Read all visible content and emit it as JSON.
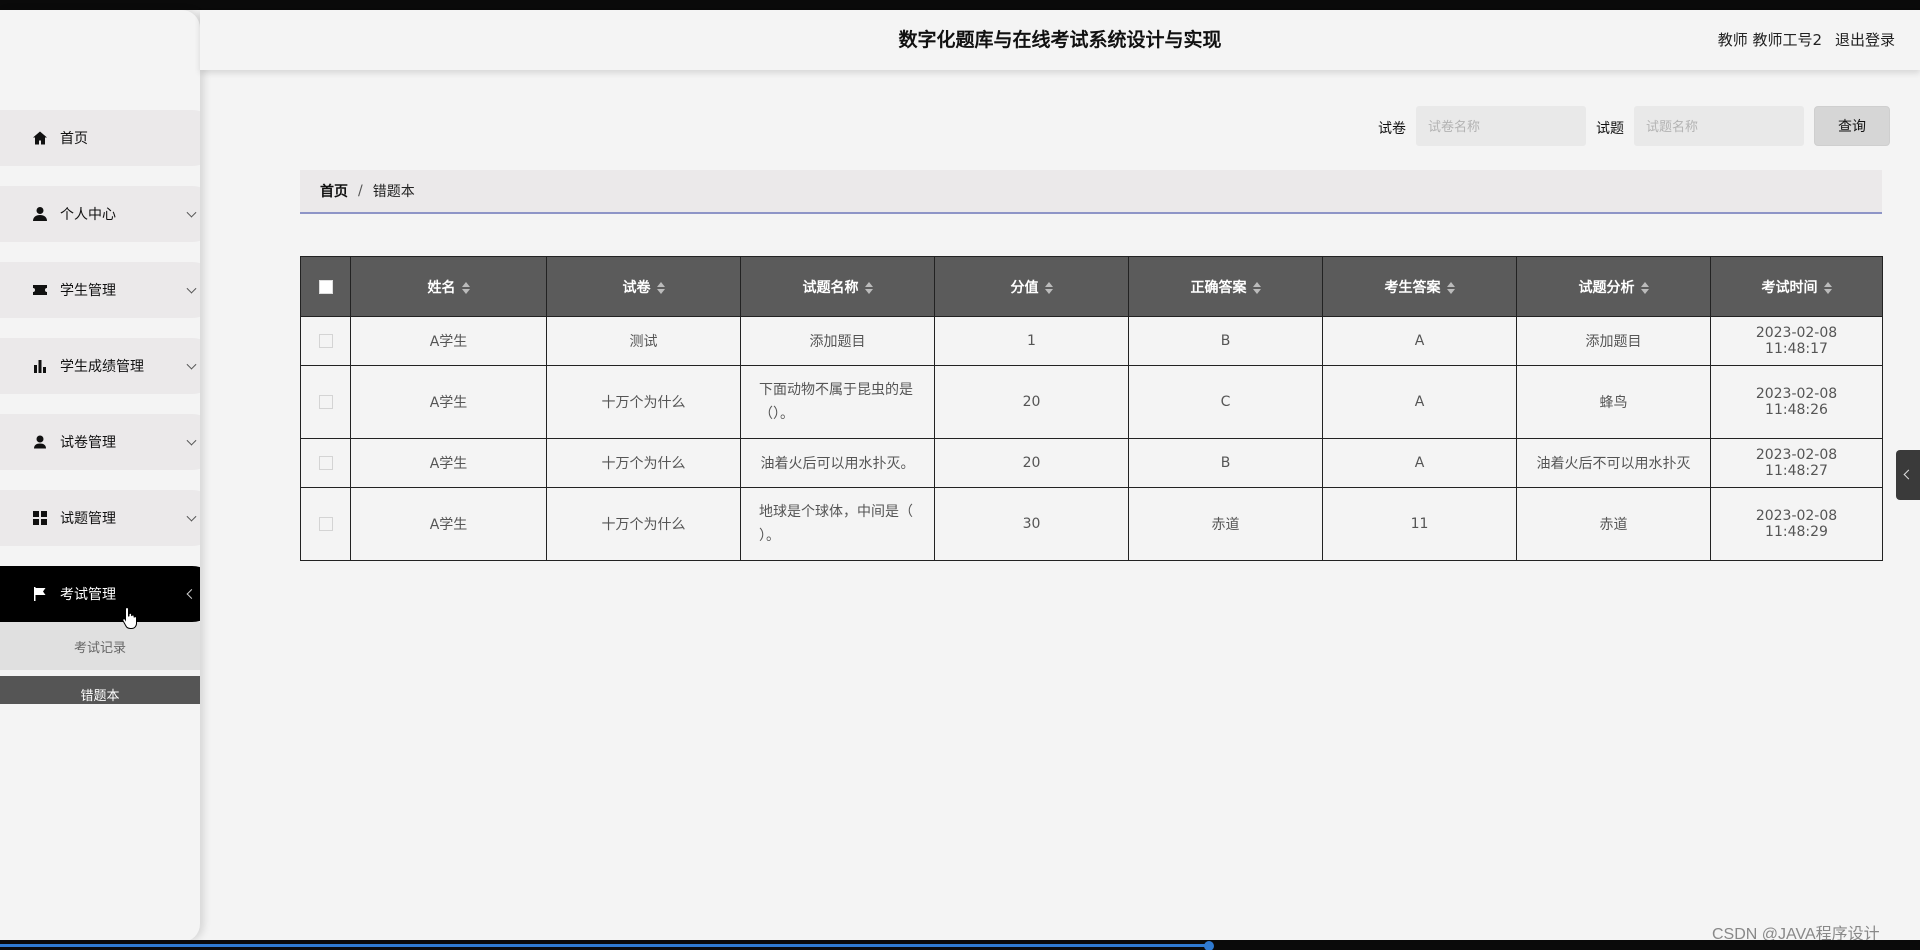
{
  "header": {
    "title": "数字化题库与在线考试系统设计与实现",
    "user": "教师 教师工号2",
    "logout": "退出登录"
  },
  "sidebar": {
    "items": [
      {
        "label": "首页",
        "icon": "home-icon"
      },
      {
        "label": "个人中心",
        "icon": "user-icon"
      },
      {
        "label": "学生管理",
        "icon": "ticket-icon"
      },
      {
        "label": "学生成绩管理",
        "icon": "bar-chart-icon"
      },
      {
        "label": "试卷管理",
        "icon": "person-icon"
      },
      {
        "label": "试题管理",
        "icon": "grid-icon"
      },
      {
        "label": "考试管理",
        "icon": "flag-icon"
      }
    ],
    "sub_items": [
      "考试记录",
      "错题本"
    ]
  },
  "search": {
    "paper_label": "试卷",
    "paper_placeholder": "试卷名称",
    "question_label": "试题",
    "question_placeholder": "试题名称",
    "button": "查询"
  },
  "breadcrumb": {
    "home": "首页",
    "separator": "/",
    "current": "错题本"
  },
  "table": {
    "headers": [
      "姓名",
      "试卷",
      "试题名称",
      "分值",
      "正确答案",
      "考生答案",
      "试题分析",
      "考试时间"
    ],
    "rows": [
      {
        "name": "A学生",
        "paper": "测试",
        "question": "添加题目",
        "score": "1",
        "correct": "B",
        "answer": "A",
        "analysis": "添加题目",
        "time": "2023-02-08 11:48:17"
      },
      {
        "name": "A学生",
        "paper": "十万个为什么",
        "question": "下面动物不属于昆虫的是（）。",
        "score": "20",
        "correct": "C",
        "answer": "A",
        "analysis": "蜂鸟",
        "time": "2023-02-08 11:48:26"
      },
      {
        "name": "A学生",
        "paper": "十万个为什么",
        "question": "油着火后可以用水扑灭。",
        "score": "20",
        "correct": "B",
        "answer": "A",
        "analysis": "油着火后不可以用水扑灭",
        "time": "2023-02-08 11:48:27"
      },
      {
        "name": "A学生",
        "paper": "十万个为什么",
        "question": "地球是个球体，中间是（ ）。",
        "score": "30",
        "correct": "赤道",
        "answer": "11",
        "analysis": "赤道",
        "time": "2023-02-08 11:48:29"
      }
    ]
  },
  "watermark": "CSDN @JAVA程序设计",
  "colors": {
    "active_menu": "#000000",
    "table_header": "#5b5b5b",
    "breadcrumb_underline": "#8e95c7"
  }
}
